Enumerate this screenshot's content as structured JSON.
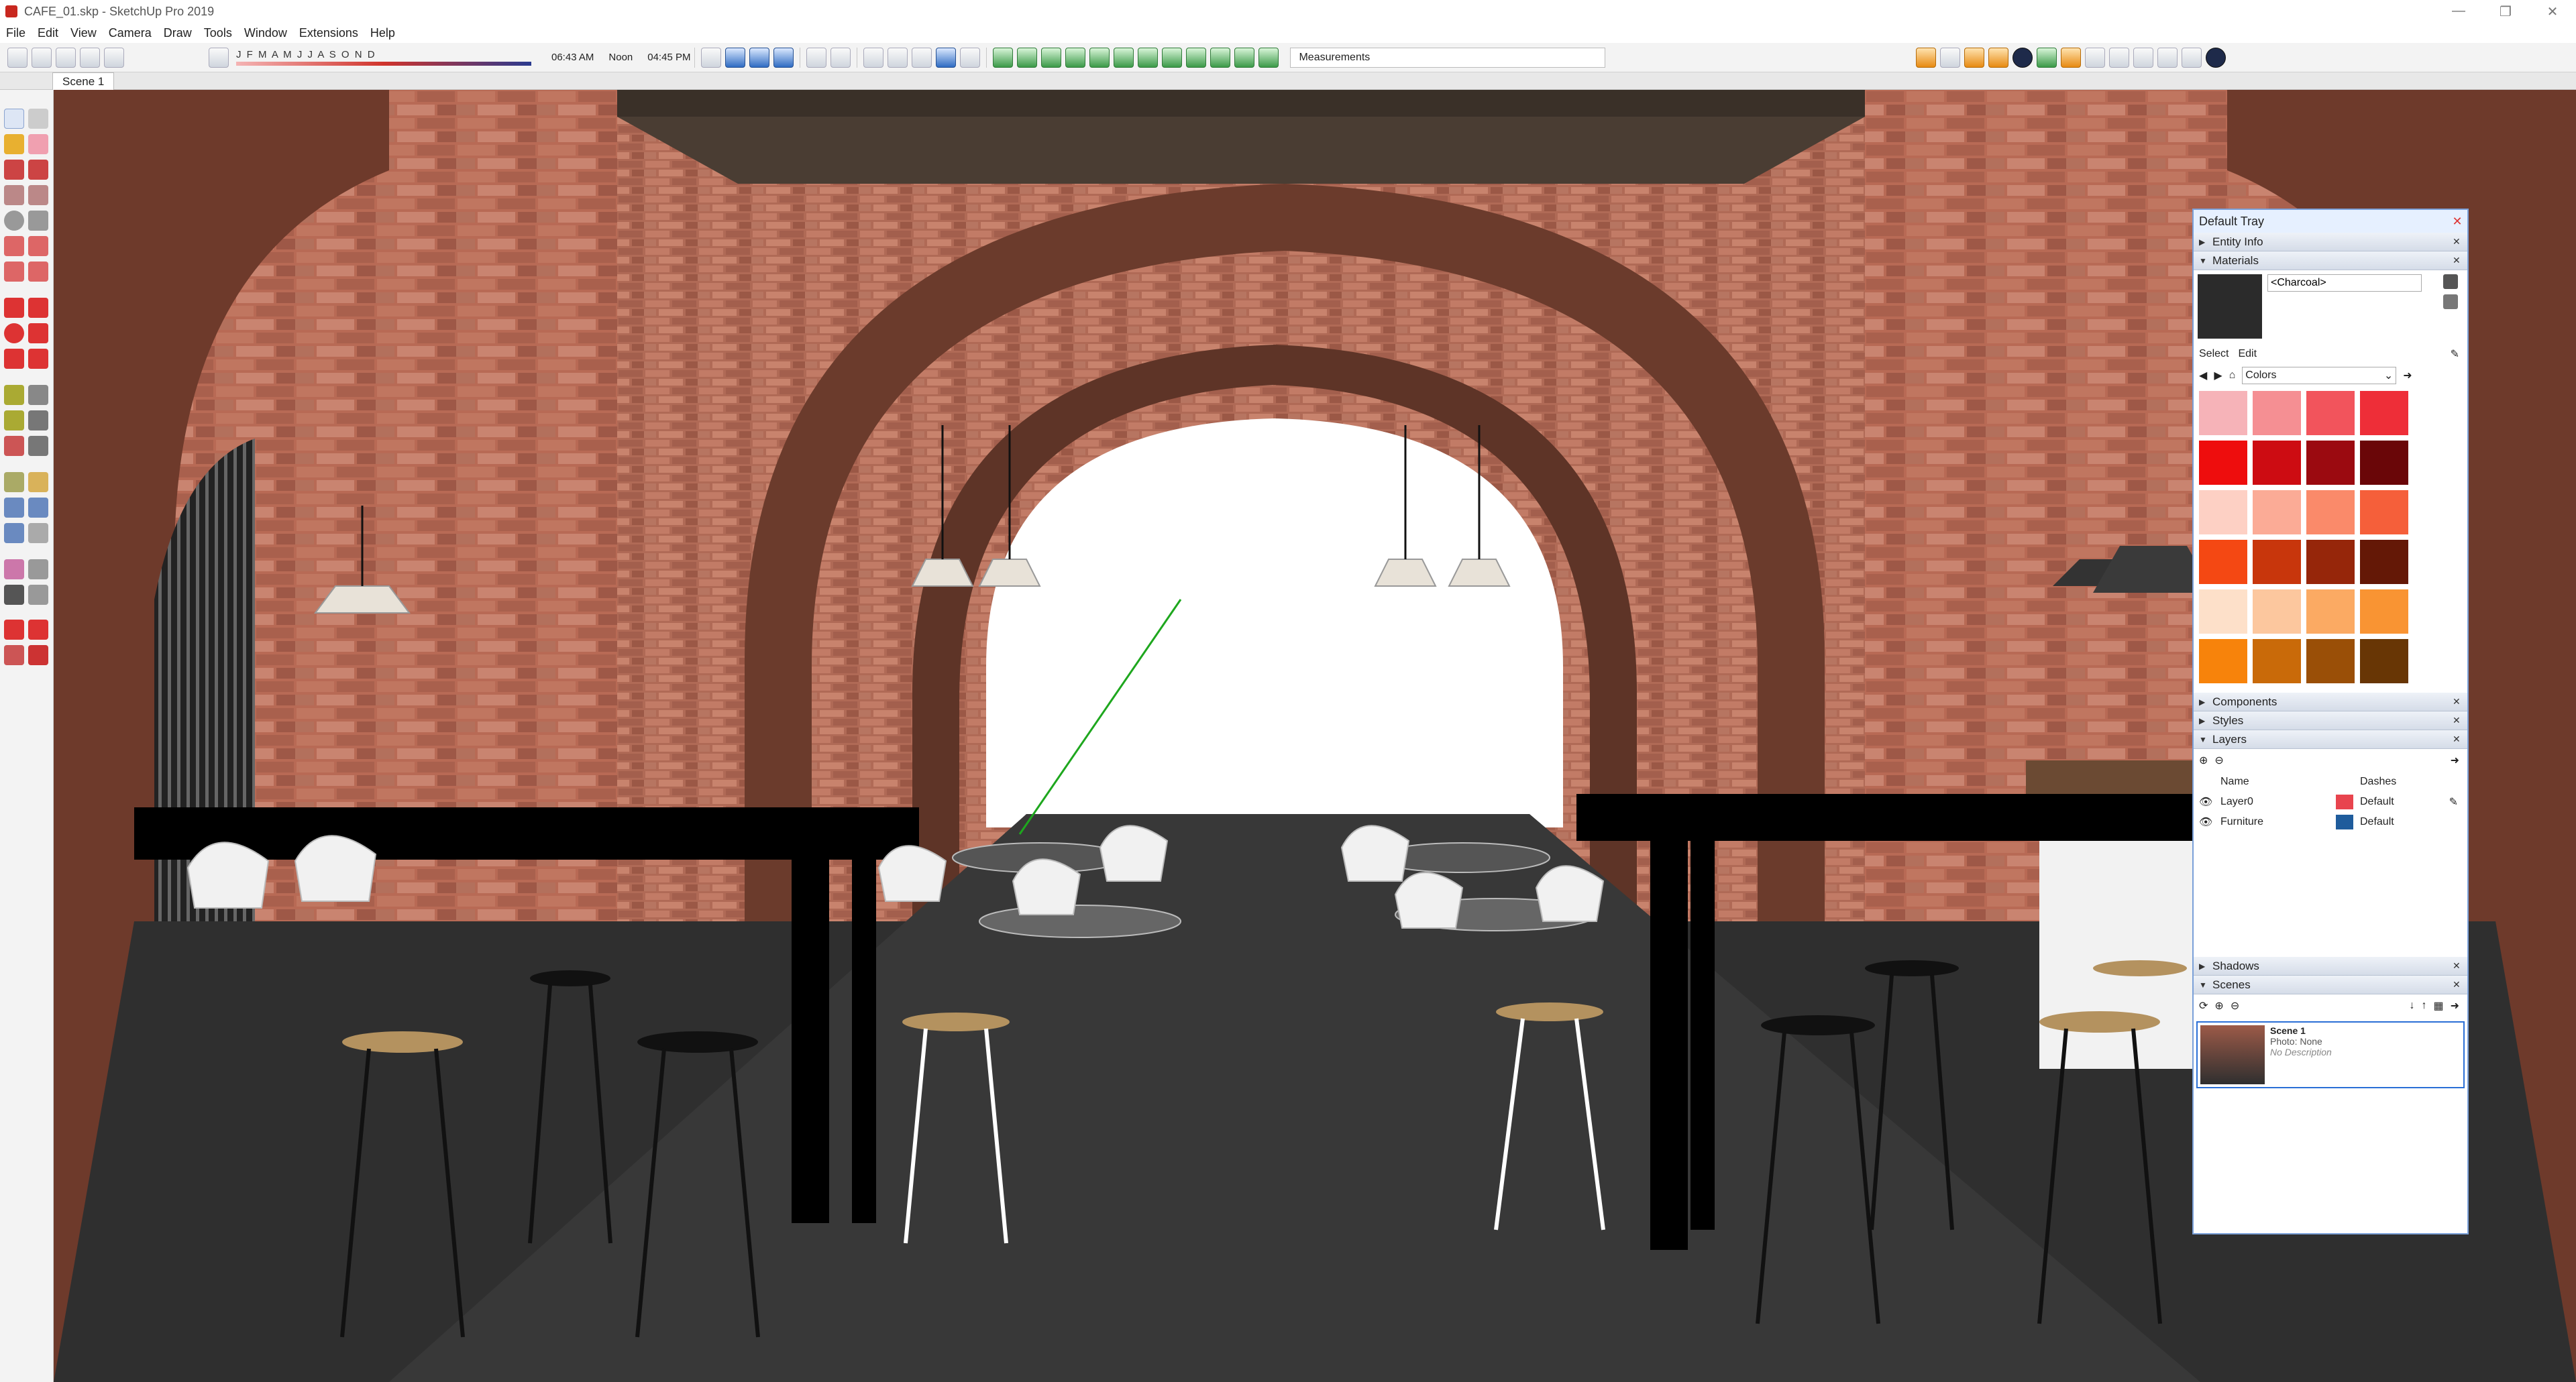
{
  "window": {
    "title": "CAFE_01.skp - SketchUp Pro 2019",
    "controls": [
      "—",
      "❐",
      "✕"
    ]
  },
  "menu": [
    "File",
    "Edit",
    "View",
    "Camera",
    "Draw",
    "Tools",
    "Window",
    "Extensions",
    "Help"
  ],
  "shadow_settings": {
    "months": "J F M A M J J A S O N D",
    "time_start": "06:43 AM",
    "time_mid": "Noon",
    "time_end": "04:45 PM"
  },
  "measurements": {
    "label": "Measurements"
  },
  "scene_tabs": [
    "Scene 1"
  ],
  "tray": {
    "title": "Default Tray",
    "close": "✕",
    "panels": {
      "entity_info": "Entity Info",
      "materials": "Materials",
      "components": "Components",
      "styles": "Styles",
      "layers": "Layers",
      "shadows": "Shadows",
      "scenes": "Scenes"
    },
    "materials": {
      "current_name": "<Charcoal>",
      "current_color": "#2b2b2b",
      "tab_select": "Select",
      "tab_edit": "Edit",
      "library": "Colors",
      "swatches": [
        "#f6b3b8",
        "#f58f93",
        "#f2545c",
        "#ee2e38",
        "#ee0d0d",
        "#cd0c12",
        "#9b0a10",
        "#6a0608",
        "#fdd0c4",
        "#fbab96",
        "#fa8a6a",
        "#f55f3a",
        "#f44813",
        "#c8360c",
        "#96260a",
        "#641806",
        "#fde0c9",
        "#fcc79e",
        "#fbaa63",
        "#f99433",
        "#f7830b",
        "#c96a09",
        "#9a4f07",
        "#683605"
      ]
    },
    "layers": {
      "col_name": "Name",
      "col_dashes": "Dashes",
      "rows": [
        {
          "name": "Layer0",
          "color": "#e8444e",
          "dashes": "Default"
        },
        {
          "name": "Furniture",
          "color": "#1f5c9c",
          "dashes": "Default"
        }
      ]
    },
    "scenes": {
      "items": [
        {
          "title": "Scene 1",
          "photo": "Photo: None",
          "description": "No Description"
        }
      ]
    }
  }
}
